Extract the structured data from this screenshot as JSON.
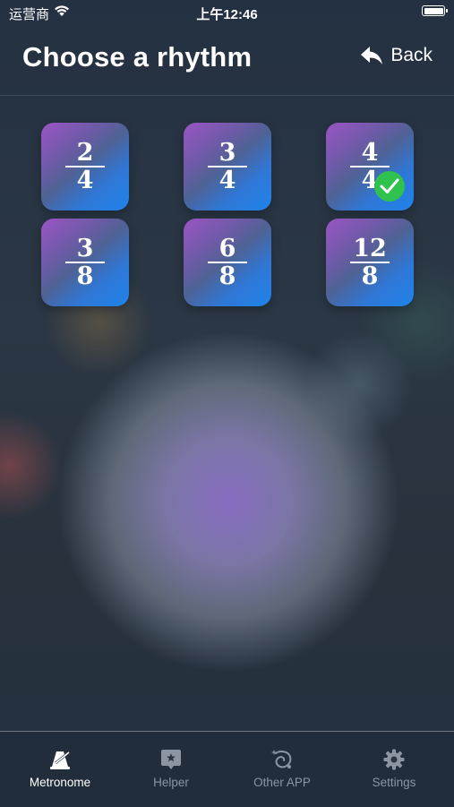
{
  "status_bar": {
    "carrier": "运营商",
    "time": "上午12:46"
  },
  "header": {
    "title": "Choose a rhythm",
    "back_label": "Back"
  },
  "rhythms": [
    {
      "numerator": "2",
      "denominator": "4",
      "selected": false
    },
    {
      "numerator": "3",
      "denominator": "4",
      "selected": false
    },
    {
      "numerator": "4",
      "denominator": "4",
      "selected": true
    },
    {
      "numerator": "3",
      "denominator": "8",
      "selected": false
    },
    {
      "numerator": "6",
      "denominator": "8",
      "selected": false
    },
    {
      "numerator": "12",
      "denominator": "8",
      "selected": false
    }
  ],
  "tabs": [
    {
      "label": "Metronome",
      "icon": "metronome-icon",
      "active": true
    },
    {
      "label": "Helper",
      "icon": "helper-icon",
      "active": false
    },
    {
      "label": "Other APP",
      "icon": "other-app-icon",
      "active": false
    },
    {
      "label": "Settings",
      "icon": "gear-icon",
      "active": false
    }
  ],
  "colors": {
    "accent_check": "#2fc24f",
    "tile_start": "#9a55c4",
    "tile_end": "#1f83ea",
    "inactive_tab": "#8c96a2"
  }
}
